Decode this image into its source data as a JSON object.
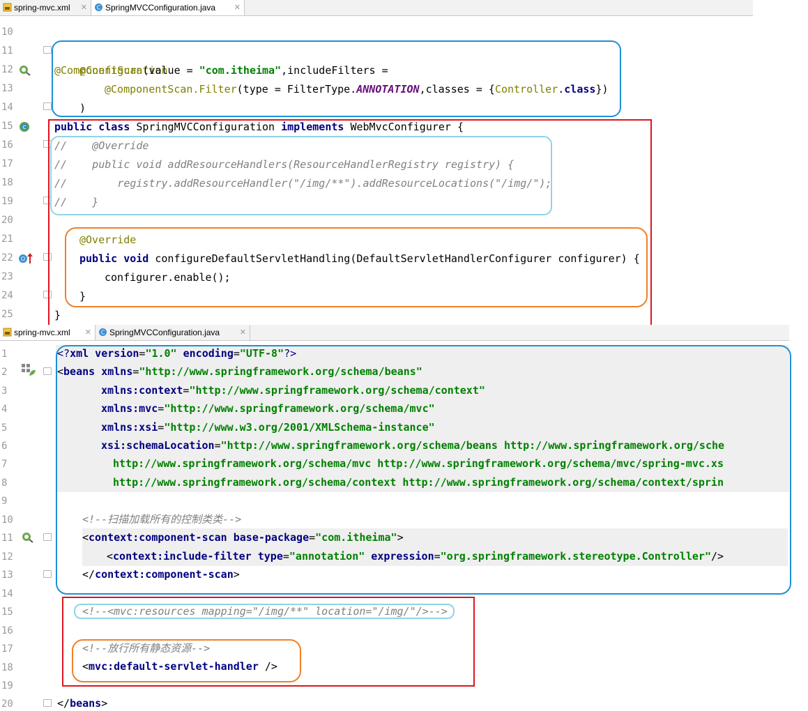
{
  "editor_top": {
    "tabs": [
      {
        "label": "spring-mvc.xml",
        "active": false,
        "icon": "xml-file-icon"
      },
      {
        "label": "SpringMVCConfiguration.java",
        "active": true,
        "icon": "java-class-icon"
      }
    ],
    "lines": [
      {
        "n": "10"
      },
      {
        "n": "11"
      },
      {
        "n": "12"
      },
      {
        "n": "13"
      },
      {
        "n": "14"
      },
      {
        "n": "15"
      },
      {
        "n": "16"
      },
      {
        "n": "17"
      },
      {
        "n": "18"
      },
      {
        "n": "19"
      },
      {
        "n": "20"
      },
      {
        "n": "21"
      },
      {
        "n": "22"
      },
      {
        "n": "23"
      },
      {
        "n": "24"
      },
      {
        "n": "25"
      }
    ],
    "code": {
      "l11": "@Configuration",
      "l12a": "@ComponentScan",
      "l12b": "(value = ",
      "l12c": "\"com.itheima\"",
      "l12d": ",includeFilters =",
      "l13a": "@ComponentScan.Filter",
      "l13b": "(type = FilterType.",
      "l13c": "ANNOTATION",
      "l13d": ",classes = {",
      "l13e": "Controller",
      "l13f": ".",
      "l13g": "class",
      "l13h": "})",
      "l14": ")",
      "l15a": "public class ",
      "l15b": "SpringMVCConfiguration ",
      "l15c": "implements ",
      "l15d": "WebMvcConfigurer {",
      "l16": "//    @Override",
      "l17": "//    public void addResourceHandlers(ResourceHandlerRegistry registry) {",
      "l18": "//        registry.addResourceHandler(\"/img/**\").addResourceLocations(\"/img/\");",
      "l19": "//    }",
      "l21": "@Override",
      "l22a": "public void ",
      "l22b": "configureDefaultServletHandling(DefaultServletHandlerConfigurer configurer) {",
      "l23": "configurer.enable();",
      "l24": "}",
      "l25": "}"
    }
  },
  "editor_bottom": {
    "tabs": [
      {
        "label": "spring-mvc.xml",
        "active": true,
        "icon": "xml-file-icon"
      },
      {
        "label": "SpringMVCConfiguration.java",
        "active": false,
        "icon": "java-class-icon"
      }
    ],
    "lines": [
      {
        "n": "1"
      },
      {
        "n": "2"
      },
      {
        "n": "3"
      },
      {
        "n": "4"
      },
      {
        "n": "5"
      },
      {
        "n": "6"
      },
      {
        "n": "7"
      },
      {
        "n": "8"
      },
      {
        "n": "9"
      },
      {
        "n": "10"
      },
      {
        "n": "11"
      },
      {
        "n": "12"
      },
      {
        "n": "13"
      },
      {
        "n": "14"
      },
      {
        "n": "15"
      },
      {
        "n": "16"
      },
      {
        "n": "17"
      },
      {
        "n": "18"
      },
      {
        "n": "19"
      },
      {
        "n": "20"
      }
    ],
    "code": {
      "x1a": "<?",
      "x1b": "xml version",
      "x1c": "=",
      "x1d": "\"1.0\"",
      "x1e": " encoding",
      "x1f": "=",
      "x1g": "\"UTF-8\"",
      "x1h": "?>",
      "x2a": "<",
      "x2b": "beans ",
      "x2c": "xmlns",
      "x2d": "=",
      "x2e": "\"http://www.springframework.org/schema/beans\"",
      "x3a": "xmlns:context",
      "x3b": "=",
      "x3c": "\"http://www.springframework.org/schema/context\"",
      "x4a": "xmlns:mvc",
      "x4b": "=",
      "x4c": "\"http://www.springframework.org/schema/mvc\"",
      "x5a": "xmlns:xsi",
      "x5b": "=",
      "x5c": "\"http://www.w3.org/2001/XMLSchema-instance\"",
      "x6a": "xsi:schemaLocation",
      "x6b": "=",
      "x6c": "\"http://www.springframework.org/schema/beans http://www.springframework.org/sche",
      "x7": "http://www.springframework.org/schema/mvc http://www.springframework.org/schema/mvc/spring-mvc.xs",
      "x8": "http://www.springframework.org/schema/context http://www.springframework.org/schema/context/sprin",
      "x10": "<!--扫描加载所有的控制类类-->",
      "x11a": "<",
      "x11b": "context:component-scan ",
      "x11c": "base-package",
      "x11d": "=",
      "x11e": "\"com.itheima\"",
      "x11f": ">",
      "x12a": "<",
      "x12b": "context:include-filter ",
      "x12c": "type",
      "x12d": "=",
      "x12e": "\"annotation\"",
      "x12f": " expression",
      "x12g": "=",
      "x12h": "\"org.springframework.stereotype.Controller\"",
      "x12i": "/>",
      "x13a": "</",
      "x13b": "context:component-scan",
      "x13c": ">",
      "x15": "<!--<mvc:resources mapping=\"/img/**\" location=\"/img/\"/>-->",
      "x17": "<!--放行所有静态资源-->",
      "x18a": "<",
      "x18b": "mvc:default-servlet-handler ",
      "x18c": "/>",
      "x20a": "</",
      "x20b": "beans",
      "x20c": ">"
    }
  },
  "colors": {
    "blue_box": "#1e90d6",
    "light_blue_box": "#8fd3e8",
    "red_box": "#e0141e",
    "orange_box": "#f08028"
  }
}
